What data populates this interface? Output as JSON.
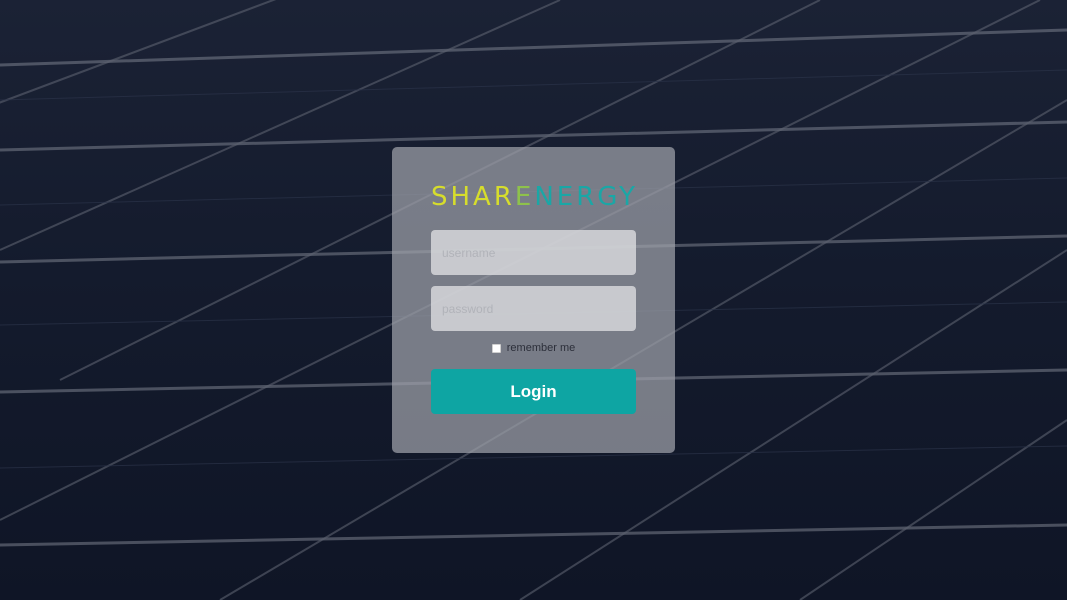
{
  "brand": {
    "logo_part1": "SHAR",
    "logo_part2": "E",
    "logo_part3": "NERGY",
    "colors": {
      "yellow": "#d6dd2c",
      "green": "#8ec24b",
      "teal": "#1aa7a6"
    }
  },
  "login_form": {
    "username_placeholder": "username",
    "username_value": "",
    "password_placeholder": "password",
    "password_value": "",
    "remember_label": "remember me",
    "remember_checked": false,
    "submit_label": "Login",
    "accent_color": "#0ea5a3"
  }
}
